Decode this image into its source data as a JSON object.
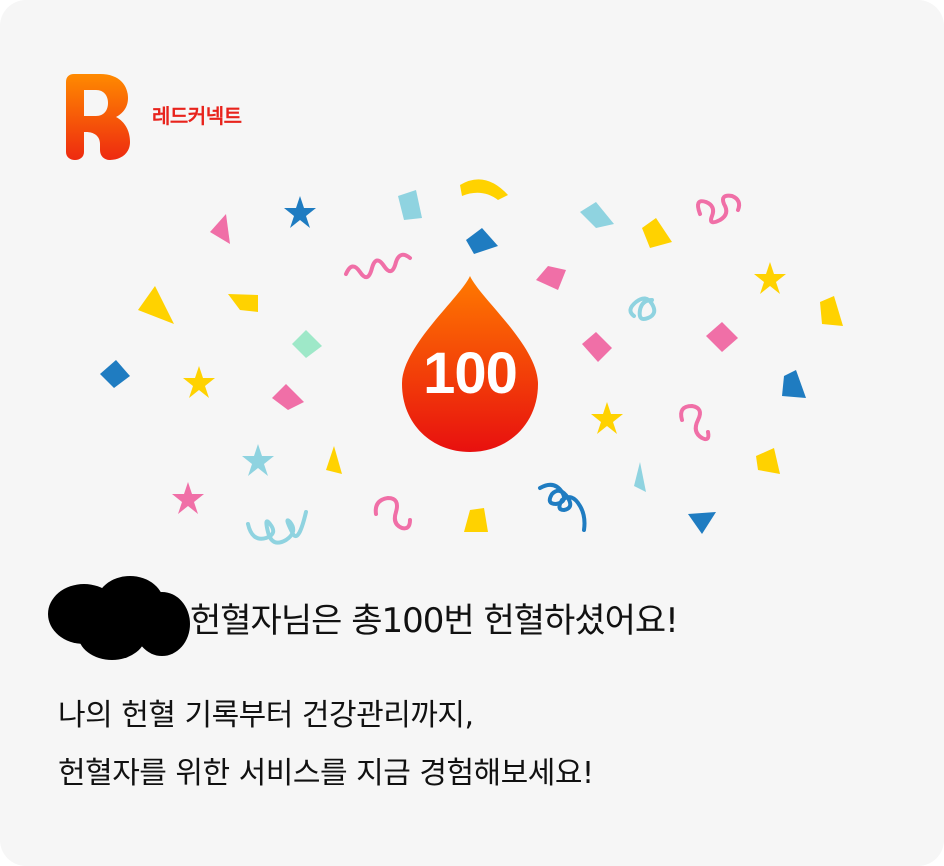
{
  "brand": {
    "name": "레드커넥트",
    "color": "#e8231c",
    "logo_icon": "r-letter-logo-icon"
  },
  "badge": {
    "count": "100",
    "icon": "blood-drop-icon"
  },
  "message": {
    "headline": "헌혈자님은 총100번 헌혈하셨어요!",
    "line1": "나의 헌혈 기록부터 건강관리까지,",
    "line2": "헌혈자를 위한 서비스를 지금 경험해보세요!"
  },
  "colors": {
    "background": "#f6f6f6",
    "drop_top": "#ff7a00",
    "drop_bottom": "#e8100f",
    "confetti": [
      "#ffd200",
      "#f06fa7",
      "#1f7cc1",
      "#8fd3e0",
      "#9ee8c8"
    ]
  }
}
